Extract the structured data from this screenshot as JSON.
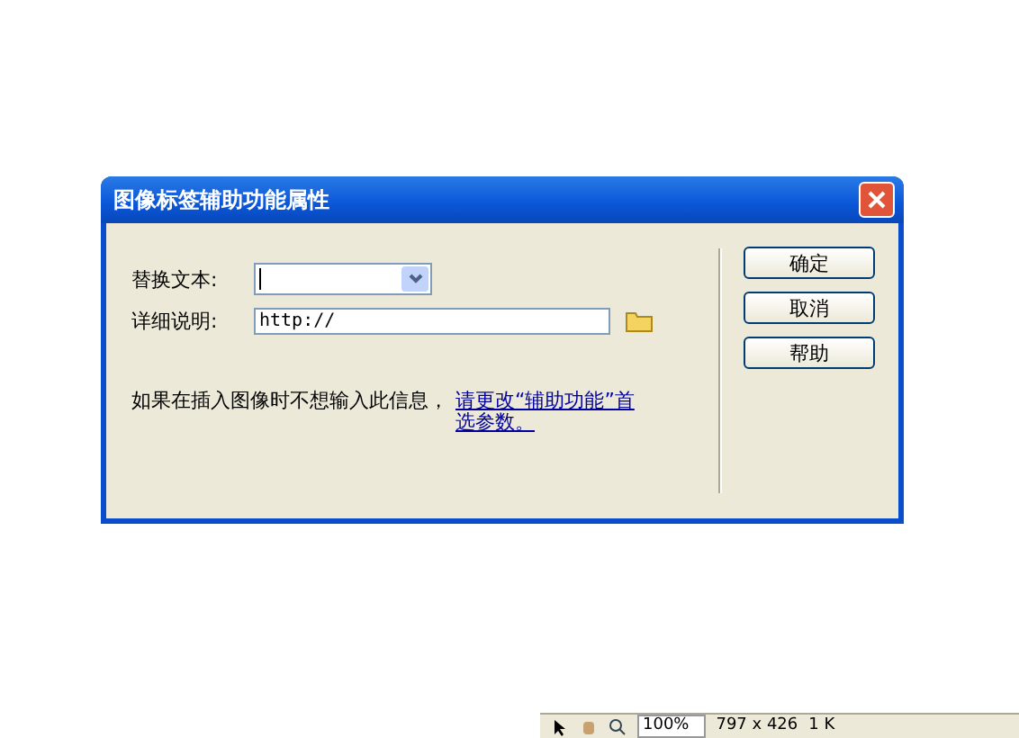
{
  "dialog": {
    "title": "图像标签辅助功能属性",
    "fields": [
      {
        "label": "替换文本:",
        "kind": "combo"
      },
      {
        "label": "详细说明:",
        "kind": "file",
        "value": "http://"
      }
    ],
    "note": "如果在插入图像时不想输入此信息，",
    "link": "请更改“辅助功能”首选参数。",
    "buttons": [
      "确定",
      "取消",
      "帮助"
    ]
  },
  "status_bar": {
    "zoom": "100%",
    "size": "797 x 426",
    "weight": "1 K"
  }
}
